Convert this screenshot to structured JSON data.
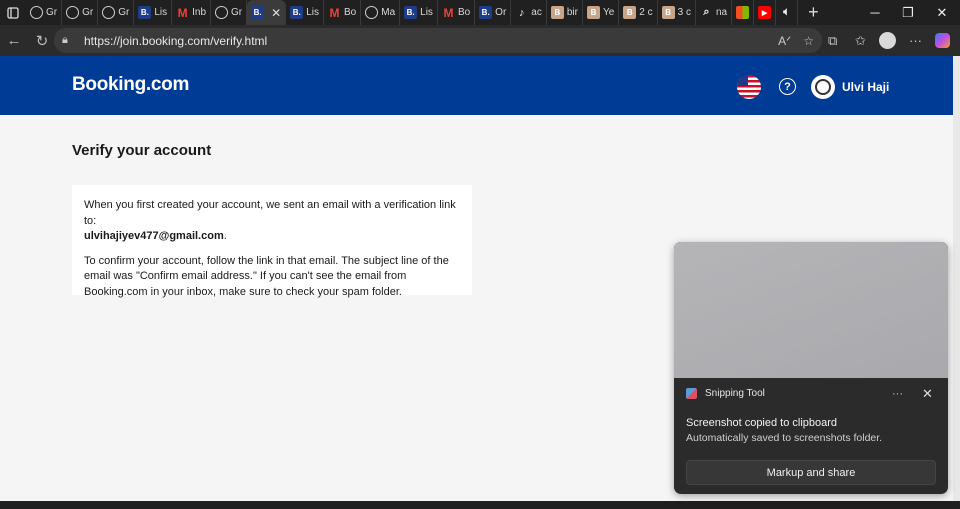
{
  "browser": {
    "tabs": [
      {
        "icon": "globe-icon",
        "label": "Gr"
      },
      {
        "icon": "globe-icon",
        "label": "Gr"
      },
      {
        "icon": "globe-icon",
        "label": "Gr"
      },
      {
        "icon": "booking-icon",
        "label": "Lis"
      },
      {
        "icon": "gmail-icon",
        "label": "Inb"
      },
      {
        "icon": "globe-icon",
        "label": "Gr"
      },
      {
        "icon": "booking-icon",
        "label": "",
        "active": true
      },
      {
        "icon": "booking-icon",
        "label": "Lis"
      },
      {
        "icon": "gmail-icon",
        "label": "Bo"
      },
      {
        "icon": "globe-icon",
        "label": "Ma"
      },
      {
        "icon": "booking-icon",
        "label": "Lis"
      },
      {
        "icon": "gmail-icon",
        "label": "Bo"
      },
      {
        "icon": "booking-icon",
        "label": "Or"
      },
      {
        "icon": "tiktok-icon",
        "label": "ac"
      },
      {
        "icon": "b-icon",
        "label": "bir"
      },
      {
        "icon": "b-icon",
        "label": "Ye"
      },
      {
        "icon": "b-icon",
        "label": "2 c"
      },
      {
        "icon": "b-icon",
        "label": "3 c"
      },
      {
        "icon": "search-icon",
        "label": "na"
      }
    ],
    "url": "https://join.booking.com/verify.html"
  },
  "booking": {
    "logo": "Booking.com",
    "username": "Ulvi Haji"
  },
  "verify": {
    "title": "Verify your account",
    "intro": "When you first created your account, we sent an email with a verification link to:",
    "email": "ulvihajiyev477@gmail.com",
    "email_suffix": ".",
    "instructions": "To confirm your account, follow the link in that email. The subject line of the email was \"Confirm email address.\" If you can't see the email from Booking.com in your inbox, make sure to check your spam folder."
  },
  "toast": {
    "app_name": "Snipping Tool",
    "more": "···",
    "title": "Screenshot copied to clipboard",
    "subtitle": "Automatically saved to screenshots folder.",
    "button": "Markup and share"
  },
  "colors": {
    "booking_blue": "#003b95",
    "page_bg": "#f5f5f5",
    "toast_bg": "#2b2b2b"
  }
}
